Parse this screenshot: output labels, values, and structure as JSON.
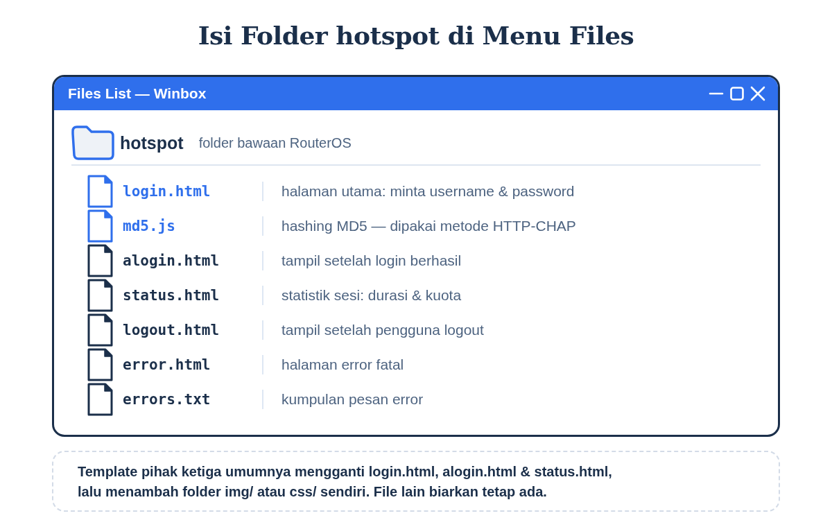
{
  "heading": "Isi Folder hotspot di Menu Files",
  "window": {
    "title": "Files List — Winbox",
    "folder": {
      "name": "hotspot",
      "description": "folder bawaan RouterOS"
    },
    "files": [
      {
        "name": "login.html",
        "description": "halaman utama: minta username & password",
        "highlighted": true
      },
      {
        "name": "md5.js",
        "description": "hashing MD5 — dipakai metode HTTP-CHAP",
        "highlighted": true
      },
      {
        "name": "alogin.html",
        "description": "tampil setelah login berhasil",
        "highlighted": false
      },
      {
        "name": "status.html",
        "description": "statistik sesi: durasi & kuota",
        "highlighted": false
      },
      {
        "name": "logout.html",
        "description": "tampil setelah pengguna logout",
        "highlighted": false
      },
      {
        "name": "error.html",
        "description": "halaman error fatal",
        "highlighted": false
      },
      {
        "name": "errors.txt",
        "description": "kumpulan pesan error",
        "highlighted": false
      }
    ]
  },
  "note": "Template pihak ketiga umumnya mengganti login.html, alogin.html & status.html,\nlalu menambah folder img/ atau css/ sendiri. File lain biarkan tetap ada."
}
